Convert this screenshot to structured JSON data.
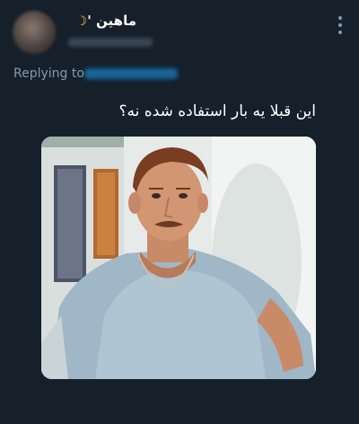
{
  "tweet": {
    "display_name": "ماهین '",
    "moon_icon": "crescent-moon-emoji",
    "text": "این قبلا یه بار استفاده شده نه؟",
    "reply_label": "Replying to",
    "media_icon": "meme-photo-man-in-blue-shirt"
  },
  "colors": {
    "background": "#15202b",
    "muted": "#8899a6",
    "link": "#1d9bf0"
  }
}
